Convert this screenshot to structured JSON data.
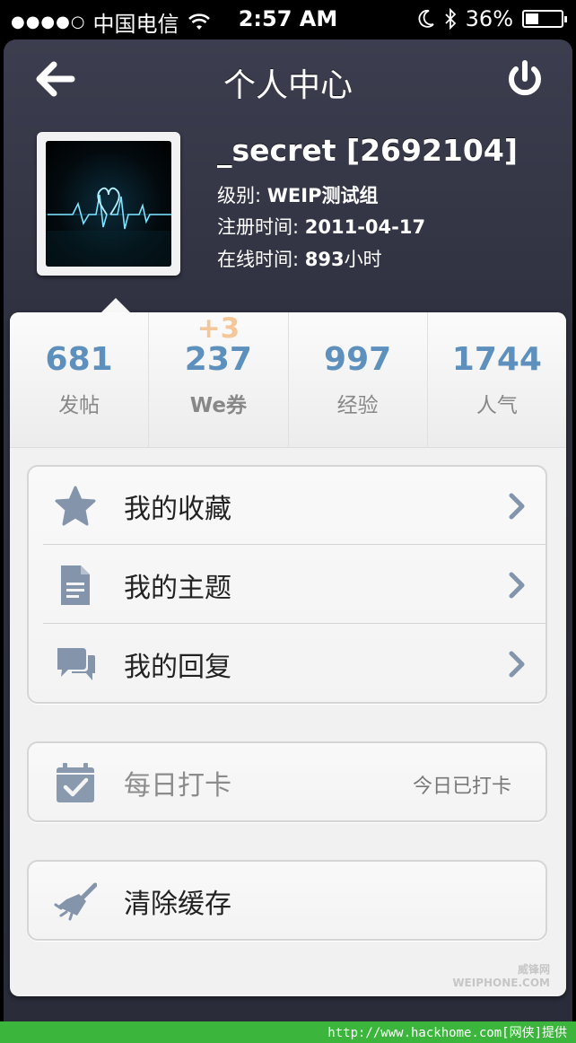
{
  "status_bar": {
    "signal": "●●●●○",
    "carrier": "中国电信",
    "time": "2:57 AM",
    "battery": "36%",
    "battery_level": 0.36
  },
  "header": {
    "title": "个人中心",
    "back_icon": "back-arrow-icon",
    "power_icon": "power-icon"
  },
  "profile": {
    "username": "_secret [2692104]",
    "level_label": "级别:",
    "level_value": "WEIP测试组",
    "reg_label": "注册时间:",
    "reg_value": "2011-04-17",
    "online_label": "在线时间:",
    "online_value": "893",
    "online_unit": "小时"
  },
  "stats": [
    {
      "value": "681",
      "label": "发帖"
    },
    {
      "value": "237",
      "label": "We券",
      "delta": "+3"
    },
    {
      "value": "997",
      "label": "经验"
    },
    {
      "value": "1744",
      "label": "人气"
    }
  ],
  "menu": [
    {
      "label": "我的收藏",
      "icon": "star-icon"
    },
    {
      "label": "我的主题",
      "icon": "document-icon"
    },
    {
      "label": "我的回复",
      "icon": "chat-bubbles-icon"
    }
  ],
  "checkin": {
    "label": "每日打卡",
    "status": "今日已打卡",
    "icon": "calendar-check-icon"
  },
  "clear_cache": {
    "label": "清除缓存",
    "icon": "broom-icon"
  },
  "watermark": {
    "line1": "威锋网",
    "line2": "WEIPHONE.COM"
  },
  "footer": {
    "text": "http://www.hackhome.com[网侠]提供"
  },
  "colors": {
    "accent": "#5d90bd",
    "nav_bg": "#33354a",
    "footer": "#3bb53b"
  }
}
